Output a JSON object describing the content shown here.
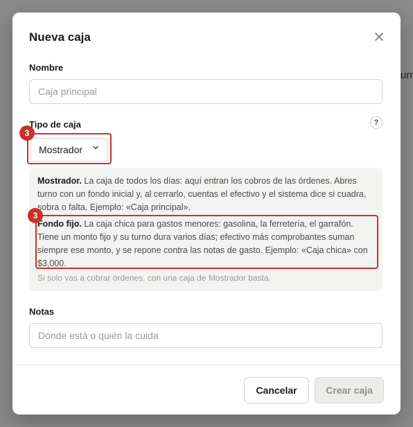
{
  "backdrop": {
    "peek_text": "urn"
  },
  "modal": {
    "title": "Nueva caja",
    "close_icon": "close-icon",
    "nombre": {
      "label": "Nombre",
      "placeholder": "Caja principal",
      "value": ""
    },
    "tipo": {
      "label": "Tipo de caja",
      "help_label": "?",
      "selected": "Mostrador",
      "chevron_icon": "chevron-down-icon"
    },
    "info": {
      "mostrador_title": "Mostrador.",
      "mostrador_text": " La caja de todos los días: aquí entran los cobros de las órdenes. Abres turno con un fondo inicial y, al cerrarlo, cuentas el efectivo y el sistema dice si cuadra, sobra o falta. Ejemplo: «Caja principal».",
      "fondo_title": "Fondo fijo.",
      "fondo_text": " La caja chica para gastos menores: gasolina, la ferretería, el garrafón. Tiene un monto fijo y su turno dura varios días; efectivo más comprobantes suman siempre ese monto, y se repone contra las notas de gasto. Ejemplo: «Caja chica» con $3,000.",
      "hint": "Si solo vas a cobrar órdenes, con una caja de Mostrador basta."
    },
    "notas": {
      "label": "Notas",
      "placeholder": "Dónde está o quién la cuida",
      "value": ""
    },
    "buttons": {
      "cancel": "Cancelar",
      "create": "Crear caja"
    }
  },
  "annotations": [
    {
      "badge": "3",
      "target": "tipo-de-caja-select"
    },
    {
      "badge": "3",
      "target": "fondo-fijo-description"
    }
  ],
  "colors": {
    "annotation": "#c8312b",
    "backdrop": "#8a8a8a",
    "info_bg": "#f3f3f2"
  }
}
